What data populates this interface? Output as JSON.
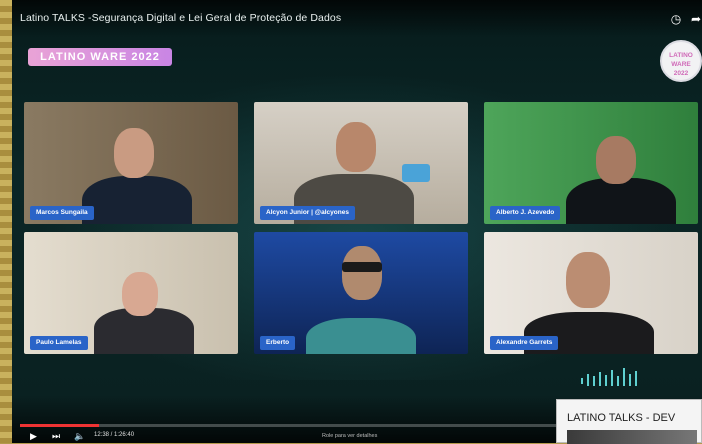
{
  "video": {
    "title": "Latino TALKS -Segurança Digital e Lei Geral de Proteção de Dados",
    "badge": "LATINO WARE 2022",
    "logo_lines": [
      "LATINO",
      "WARE",
      "2022"
    ],
    "participants": [
      {
        "name": "Marcos Sungaila",
        "bg": "#7a6a52"
      },
      {
        "name": "Alcyon Junior | @alcyones",
        "bg": "#c7bfb0"
      },
      {
        "name": "Alberto J. Azevedo",
        "bg": "#3f9a4b"
      },
      {
        "name": "Paulo Lamelas",
        "bg": "#d8d0bf"
      },
      {
        "name": "Erberto",
        "bg": "#1a3a86"
      },
      {
        "name": "Alexandre Garrets",
        "bg": "#e7e2dc"
      }
    ]
  },
  "player": {
    "time": "12:38 / 1:26:40",
    "hint": "Role para ver detalhes",
    "progress": 0.147,
    "play_icon": "play-icon",
    "next_icon": "next-icon",
    "volume_icon": "volume-icon",
    "clock_icon": "clock-icon",
    "share_icon": "share-icon"
  },
  "popup": {
    "title": "LATINO TALKS - DEV"
  }
}
